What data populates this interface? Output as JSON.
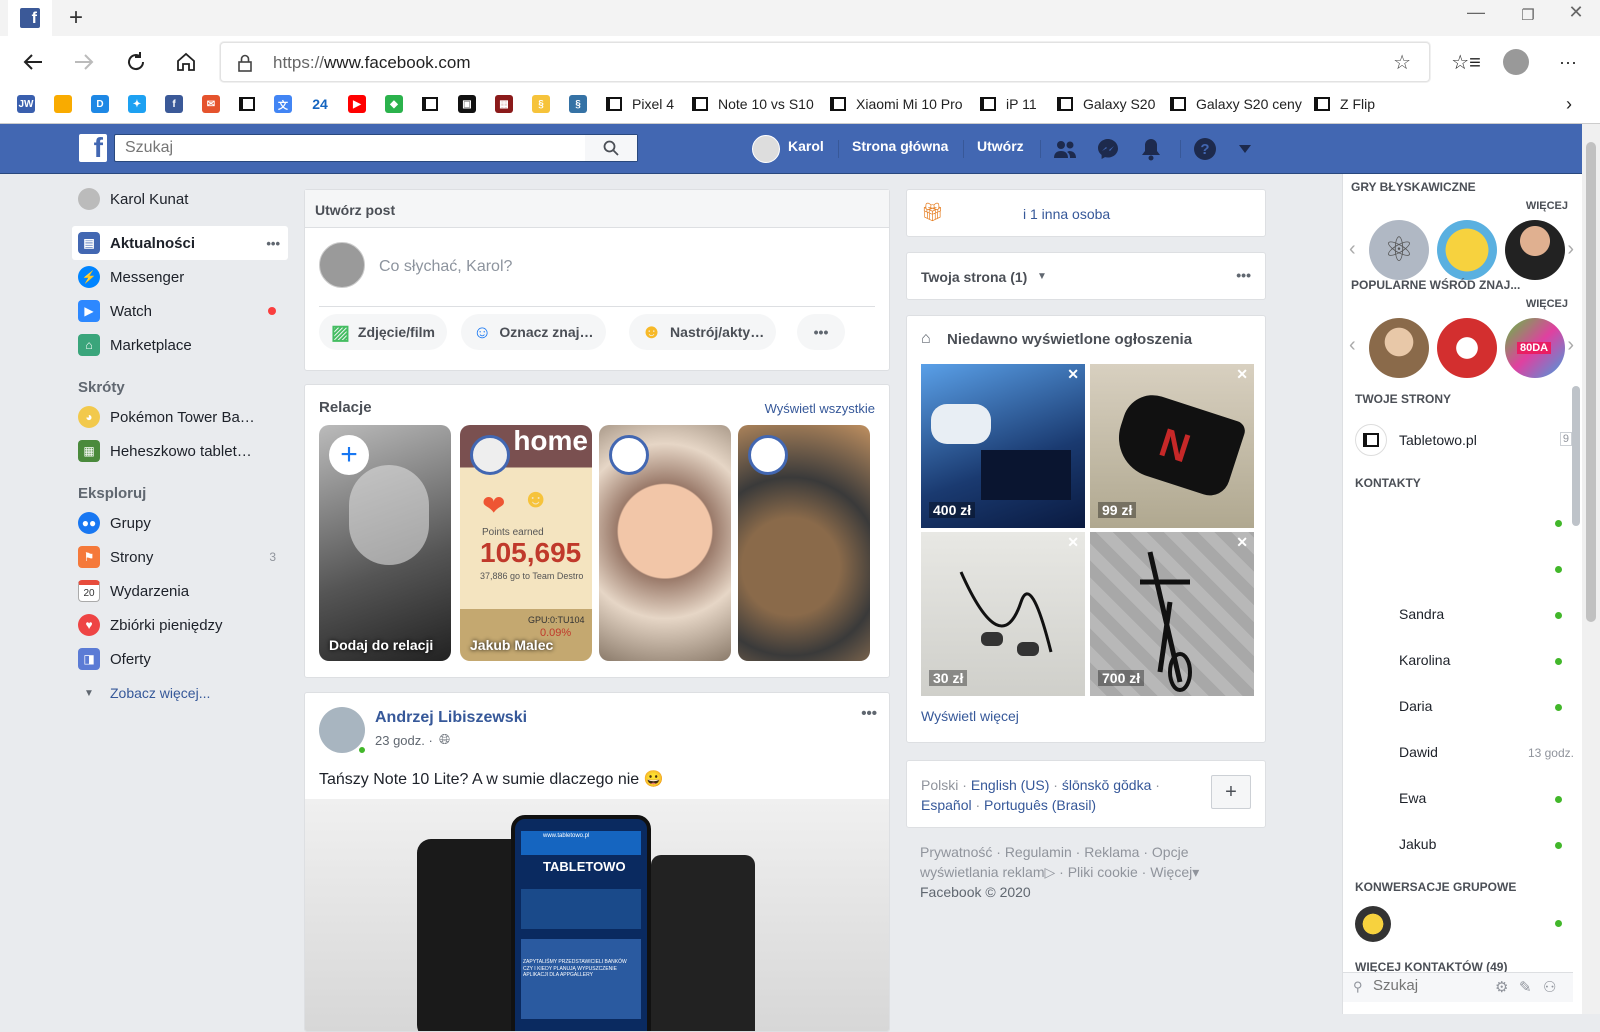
{
  "browser": {
    "url_prefix": "https://",
    "url_host": "www.facebook.com",
    "bookmarks": [
      "Pixel 4",
      "Note 10 vs S10",
      "Xiaomi Mi 10 Pro",
      "iP 11",
      "Galaxy S20",
      "Galaxy S20 ceny",
      "Z Flip"
    ],
    "bookmark_icons": [
      "JW",
      "",
      "D",
      "",
      "f",
      "",
      "",
      "",
      "24",
      "",
      "",
      "",
      "",
      "",
      "",
      ""
    ]
  },
  "fb": {
    "search_placeholder": "Szukaj",
    "user": "Karol",
    "home": "Strona główna",
    "create": "Utwórz"
  },
  "leftnav": {
    "profile": "Karol Kunat",
    "items": [
      {
        "label": "Aktualności",
        "more": "•••"
      },
      {
        "label": "Messenger"
      },
      {
        "label": "Watch"
      },
      {
        "label": "Marketplace"
      }
    ],
    "shortcuts_head": "Skróty",
    "shortcuts": [
      "Pokémon Tower Ba…",
      "Heheszkowo tablet…"
    ],
    "explore_head": "Eksploruj",
    "explore": [
      {
        "label": "Grupy",
        "count": ""
      },
      {
        "label": "Strony",
        "count": "3"
      },
      {
        "label": "Wydarzenia",
        "count": ""
      },
      {
        "label": "Zbiórki pieniędzy",
        "count": ""
      },
      {
        "label": "Oferty",
        "count": ""
      }
    ],
    "see_more": "Zobacz więcej...",
    "calendar_day": "20"
  },
  "composer": {
    "title": "Utwórz post",
    "placeholder": "Co słychać, Karol?",
    "actions": [
      "Zdjęcie/film",
      "Oznacz znaj…",
      "Nastrój/akty…"
    ],
    "more": "•••"
  },
  "stories": {
    "title": "Relacje",
    "view_all": "Wyświetl wszystkie",
    "items": [
      {
        "name": "Dodaj do relacji"
      },
      {
        "name": "Jakub Malec"
      },
      {
        "name": ""
      },
      {
        "name": ""
      }
    ],
    "story2_text": {
      "home": "home",
      "points_label": "Points earned",
      "points": "105,695",
      "team": "37,886 go to Team Destro",
      "gpu": "GPU:0:TU104",
      "percent": "0.09%"
    }
  },
  "post": {
    "author": "Andrzej Libiszewski",
    "time": "23 godz. ·",
    "more": "•••",
    "text": "Tańszy Note 10 Lite? A w sumie dlaczego nie 😀",
    "phone_brand": "TABLETOWO",
    "phone_url": "www.tabletowo.pl",
    "phone_caption": "ZAPYTALIŚMY PRZEDSTAWICIELI BANKÓW CZY I KIEDY PLANUJĄ WYPUSZCZENIE APLIKACJI DLA APPGALLERY"
  },
  "birthday": {
    "text": "i 1 inna osoba"
  },
  "your_page": {
    "title": "Twoja strona (1)",
    "more": "•••"
  },
  "recent_ads": {
    "title": "Niedawno wyświetlone ogłoszenia",
    "items": [
      {
        "price": "400 zł"
      },
      {
        "price": "99 zł"
      },
      {
        "price": "30 zł"
      },
      {
        "price": "700 zł"
      }
    ],
    "see_more": "Wyświetl więcej"
  },
  "languages": {
    "current": "Polski",
    "others": [
      "English (US)",
      "ślōnskŏ gŏdka",
      "Español",
      "Português (Brasil)"
    ]
  },
  "footer": {
    "links": [
      "Prywatność",
      "Regulamin",
      "Reklama",
      "Opcje wyświetlania reklam",
      "Pliki cookie",
      "Więcej"
    ],
    "copyright": "Facebook © 2020"
  },
  "right_panel": {
    "games_head": "GRY BŁYSKAWICZNE",
    "more": "WIĘCEJ",
    "popular_head": "POPULARNE WŚRÓD ZNAJ...",
    "popular_badge": "80DA",
    "pages_head": "TWOJE STRONY",
    "page": "Tabletowo.pl",
    "page_count": "9",
    "contacts_head": "KONTAKTY",
    "contacts": [
      {
        "name": "",
        "status": ""
      },
      {
        "name": "",
        "status": ""
      },
      {
        "name": "Sandra",
        "status": ""
      },
      {
        "name": "Karolina",
        "status": ""
      },
      {
        "name": "Daria",
        "status": ""
      },
      {
        "name": "Dawid",
        "status": "13 godz."
      },
      {
        "name": "Ewa",
        "status": ""
      },
      {
        "name": "Jakub",
        "status": ""
      }
    ],
    "groups_head": "KONWERSACJE GRUPOWE",
    "more_contacts": "WIĘCEJ KONTAKTÓW (49)",
    "search_placeholder": "Szukaj"
  },
  "colors": {
    "fb_blue": "#4267b2",
    "link": "#365899",
    "online": "#42b72a",
    "notif": "#fa3e3e"
  }
}
